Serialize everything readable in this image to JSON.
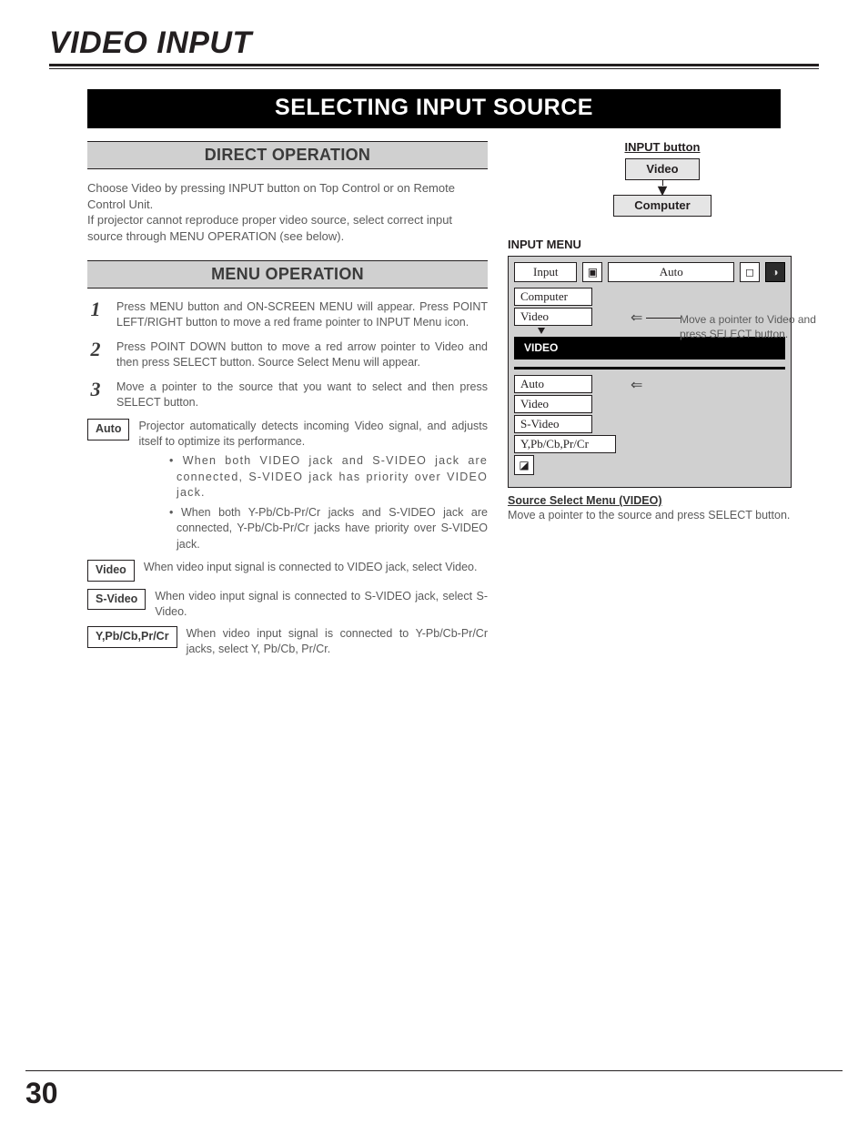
{
  "chapter": "VIDEO INPUT",
  "section_bar": "SELECTING INPUT SOURCE",
  "direct": {
    "heading": "DIRECT OPERATION",
    "p1": "Choose Video by pressing INPUT button on Top Control or on Remote Control Unit.",
    "p2": "If projector cannot reproduce proper video source, select correct input source through MENU OPERATION (see below)."
  },
  "menu": {
    "heading": "MENU OPERATION",
    "steps": [
      "Press MENU button and ON-SCREEN MENU will appear.  Press POINT LEFT/RIGHT button to move a red frame pointer to INPUT Menu icon.",
      "Press POINT DOWN button to move a red arrow pointer to Video and then press SELECT button.  Source Select Menu will appear.",
      "Move a pointer to the source that you want to select and then press SELECT button."
    ],
    "options": [
      {
        "label": "Auto",
        "text": "Projector automatically detects incoming Video signal, and adjusts itself to optimize its performance.",
        "bullets": [
          "When both VIDEO jack and S-VIDEO jack are connected, S-VIDEO jack has priority over VIDEO jack.",
          "When both Y-Pb/Cb-Pr/Cr jacks and S-VIDEO jack are connected, Y-Pb/Cb-Pr/Cr jacks have priority over S-VIDEO jack."
        ]
      },
      {
        "label": "Video",
        "text": "When video input signal is connected to VIDEO jack, select Video."
      },
      {
        "label": "S-Video",
        "text": "When video input signal is connected to S-VIDEO jack, select S-Video."
      },
      {
        "label": "Y,Pb/Cb,Pr/Cr",
        "text": "When video input signal is connected to Y-Pb/Cb-Pr/Cr jacks, select Y, Pb/Cb, Pr/Cr."
      }
    ]
  },
  "diagram": {
    "title": "INPUT button",
    "top": "Video",
    "bottom": "Computer"
  },
  "input_menu": {
    "heading": "INPUT MENU",
    "top_label": "Input",
    "top_mode": "Auto",
    "list": [
      "Computer",
      "Video"
    ],
    "callout": "Move a pointer to Video and press SELECT button.",
    "video_label": "VIDEO",
    "sub_list": [
      "Auto",
      "Video",
      "S-Video",
      "Y,Pb/Cb,Pr/Cr"
    ]
  },
  "source_select": {
    "title": "Source Select Menu (VIDEO)",
    "text": "Move a pointer to the source and press SELECT button."
  },
  "page_number": "30"
}
